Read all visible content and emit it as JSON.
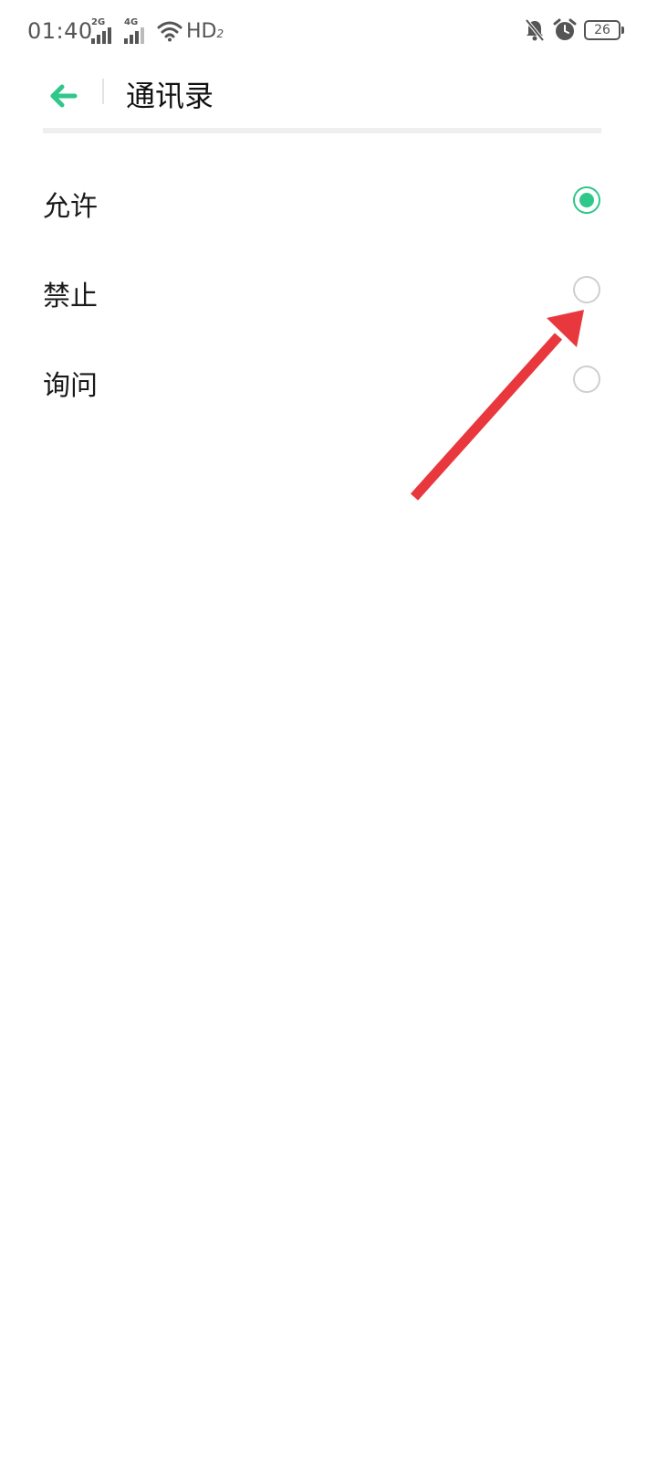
{
  "status_bar": {
    "time": "01:40",
    "network_1": "2G",
    "network_2": "4G",
    "hd_label": "HD",
    "hd_sub": "2",
    "battery": "26"
  },
  "header": {
    "title": "通讯录"
  },
  "options": [
    {
      "label": "允许",
      "selected": true
    },
    {
      "label": "禁止",
      "selected": false
    },
    {
      "label": "询问",
      "selected": false
    }
  ],
  "colors": {
    "accent": "#2fc78a",
    "annotation_arrow": "#e8383d"
  }
}
